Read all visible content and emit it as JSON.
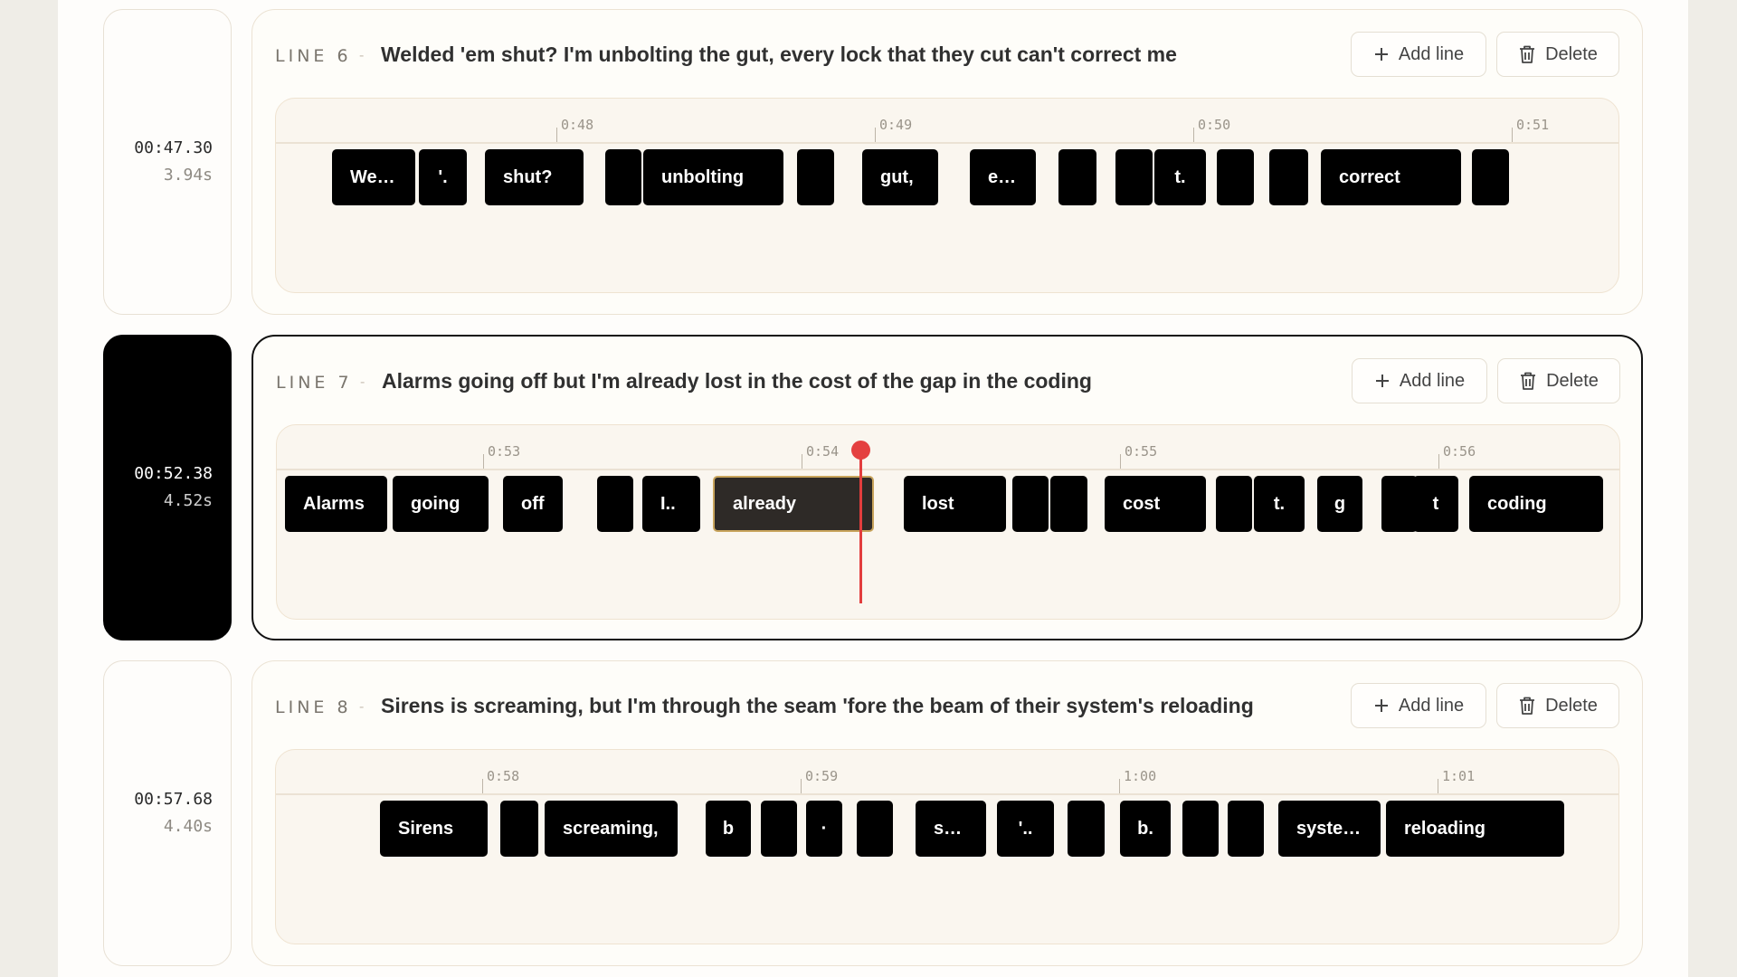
{
  "buttons": {
    "add_label": "Add line",
    "delete_label": "Delete"
  },
  "lines": [
    {
      "label": "LINE 6",
      "time": "00:47.30",
      "duration": "3.94s",
      "lyric": "Welded 'em shut? I'm unbolting the gut, every lock that they cut can't correct me",
      "ticks": [
        "0:48",
        "0:49",
        "0:50",
        "0:51"
      ],
      "words": [
        "We…",
        "'.",
        "shut?",
        "",
        "unbolting",
        "",
        "gut,",
        "e…",
        "",
        "",
        "t.",
        "",
        "",
        "correct",
        ""
      ]
    },
    {
      "label": "LINE 7",
      "time": "00:52.38",
      "duration": "4.52s",
      "lyric": "Alarms going off but I'm already lost in the cost of the gap in the coding",
      "ticks": [
        "0:53",
        "0:54",
        "0:55",
        "0:56"
      ],
      "words": [
        "Alarms",
        "going",
        "off",
        "",
        "I..",
        "already",
        "lost",
        "",
        "",
        "cost",
        "",
        "t.",
        "g",
        "",
        "t",
        "coding"
      ],
      "selected_word": "already"
    },
    {
      "label": "LINE 8",
      "time": "00:57.68",
      "duration": "4.40s",
      "lyric": "Sirens is screaming, but I'm through the seam 'fore the beam of their system's reloading",
      "ticks": [
        "0:58",
        "0:59",
        "1:00",
        "1:01"
      ],
      "words": [
        "Sirens",
        "",
        "screaming,",
        "b",
        "",
        "·",
        "",
        "s…",
        "'..",
        "",
        "b.",
        "",
        "",
        "syste…",
        "reloading"
      ]
    }
  ]
}
